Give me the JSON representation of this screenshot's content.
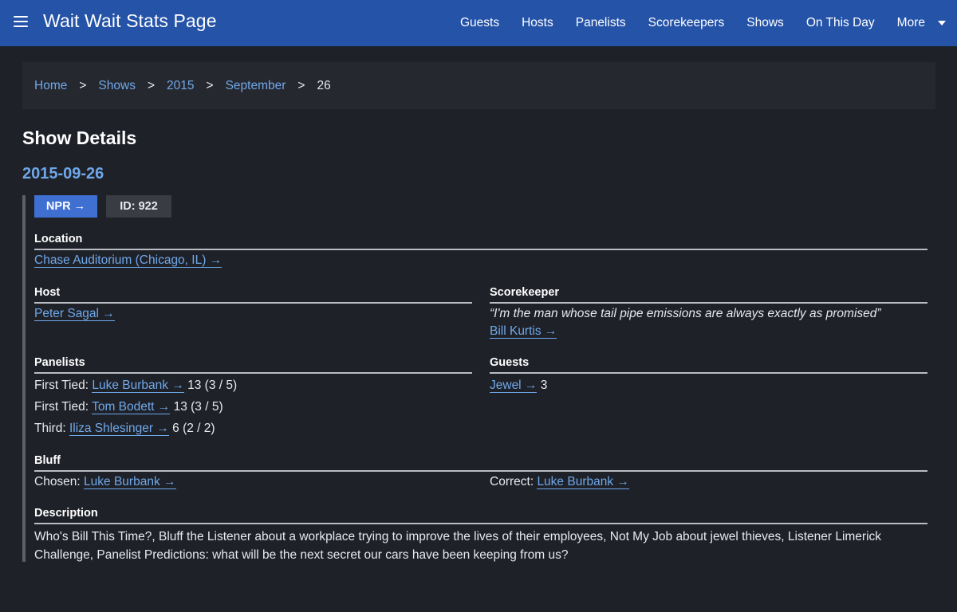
{
  "app": {
    "title": "Wait Wait Stats Page",
    "menu_icon": "hamburger-menu-icon"
  },
  "nav": {
    "items": [
      "Guests",
      "Hosts",
      "Panelists",
      "Scorekeepers",
      "Shows",
      "On This Day"
    ],
    "more_label": "More",
    "more_icon": "chevron-down-icon"
  },
  "breadcrumb": {
    "items": [
      "Home",
      "Shows",
      "2015",
      "September"
    ],
    "separator": ">",
    "current": "26"
  },
  "page": {
    "title": "Show Details",
    "date": "2015-09-26"
  },
  "badges": {
    "npr": "NPR →",
    "id": "ID: 922"
  },
  "location": {
    "heading": "Location",
    "link": "Chase Auditorium (Chicago, IL) →"
  },
  "host": {
    "heading": "Host",
    "link": "Peter Sagal →"
  },
  "scorekeeper": {
    "heading": "Scorekeeper",
    "quote": "“I'm the man whose tail pipe emissions are always exactly as promised”",
    "link": "Bill Kurtis →"
  },
  "panelists": {
    "heading": "Panelists",
    "rows": [
      {
        "rank": "First Tied: ",
        "name": "Luke Burbank →",
        "score": " 13 (3 / 5)"
      },
      {
        "rank": "First Tied: ",
        "name": "Tom Bodett →",
        "score": " 13 (3 / 5)"
      },
      {
        "rank": "Third: ",
        "name": "Iliza Shlesinger →",
        "score": " 6 (2 / 2)"
      }
    ]
  },
  "guests": {
    "heading": "Guests",
    "rows": [
      {
        "name": "Jewel →",
        "score": " 3"
      }
    ]
  },
  "bluff": {
    "heading": "Bluff",
    "chosen_label": "Chosen: ",
    "chosen_link": "Luke Burbank →",
    "correct_label": "Correct: ",
    "correct_link": "Luke Burbank →"
  },
  "description": {
    "heading": "Description",
    "text": "Who's Bill This Time?, Bluff the Listener about a workplace trying to improve the lives of their employees, Not My Job about jewel thieves, Listener Limerick Challenge, Panelist Predictions: what will be the next secret our cars have been keeping from us?"
  },
  "colors": {
    "navbar": "#2453a8",
    "background": "#1f2129",
    "link": "#6fa8e8",
    "npr_badge": "#3f6fd1"
  }
}
